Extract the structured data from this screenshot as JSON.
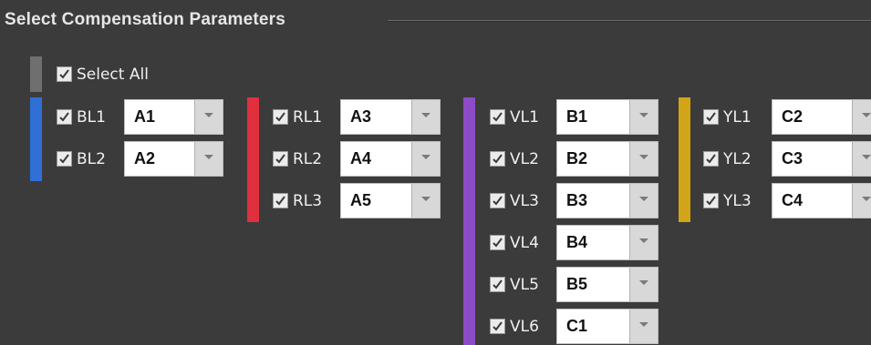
{
  "title": "Select Compensation Parameters",
  "select_all": {
    "label": "Select All",
    "checked": true
  },
  "colors": {
    "gray": "#6f6f6f",
    "blue": "#2f6fd6",
    "red": "#e0303e",
    "violet": "#8c4cc6",
    "yellow": "#d2a418"
  },
  "rows": {
    "bl1": {
      "label": "BL1",
      "value": "A1",
      "checked": true
    },
    "bl2": {
      "label": "BL2",
      "value": "A2",
      "checked": true
    },
    "rl1": {
      "label": "RL1",
      "value": "A3",
      "checked": true
    },
    "rl2": {
      "label": "RL2",
      "value": "A4",
      "checked": true
    },
    "rl3": {
      "label": "RL3",
      "value": "A5",
      "checked": true
    },
    "vl1": {
      "label": "VL1",
      "value": "B1",
      "checked": true
    },
    "vl2": {
      "label": "VL2",
      "value": "B2",
      "checked": true
    },
    "vl3": {
      "label": "VL3",
      "value": "B3",
      "checked": true
    },
    "vl4": {
      "label": "VL4",
      "value": "B4",
      "checked": true
    },
    "vl5": {
      "label": "VL5",
      "value": "B5",
      "checked": true
    },
    "vl6": {
      "label": "VL6",
      "value": "C1",
      "checked": true
    },
    "yl1": {
      "label": "YL1",
      "value": "C2",
      "checked": true
    },
    "yl2": {
      "label": "YL2",
      "value": "C3",
      "checked": true
    },
    "yl3": {
      "label": "YL3",
      "value": "C4",
      "checked": true
    }
  }
}
